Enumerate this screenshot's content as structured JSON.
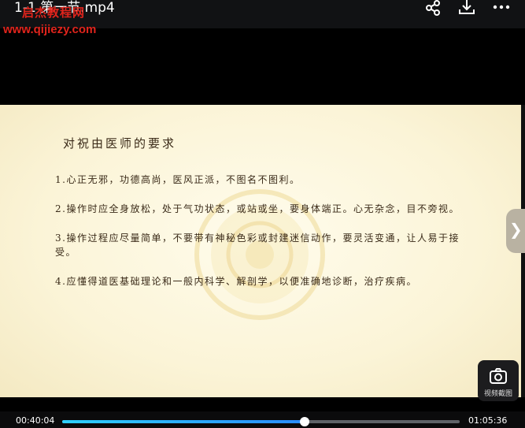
{
  "header": {
    "video_title": "1-1 第一节.mp4",
    "watermark_name": "启杰教程网",
    "watermark_url": "www.qijiezy.com",
    "icons": [
      "share-icon",
      "download-icon",
      "more-icon"
    ]
  },
  "slide": {
    "title": "对祝由医师的要求",
    "items": [
      "1.心正无邪，功德高尚，医风正派，不图名不图利。",
      "2.操作时应全身放松，处于气功状态，或站或坐，要身体端正。心无杂念，目不旁视。",
      "3.操作过程应尽量简单，不要带有神秘色彩或封建迷信动作，要灵活变通，让人易于接受。",
      "4.应懂得道医基础理论和一般内科学、解剖学，以便准确地诊断，治疗疾病。"
    ]
  },
  "screenshot_button": {
    "label": "视频截图",
    "icon": "camera-icon"
  },
  "next_button": {
    "icon": "chevron-right-icon"
  },
  "playback": {
    "current_time": "00:40:04",
    "total_time": "01:05:36",
    "progress": 0.6107,
    "colors": {
      "progress": "#2fb4ff",
      "track": "#5f6368"
    }
  }
}
